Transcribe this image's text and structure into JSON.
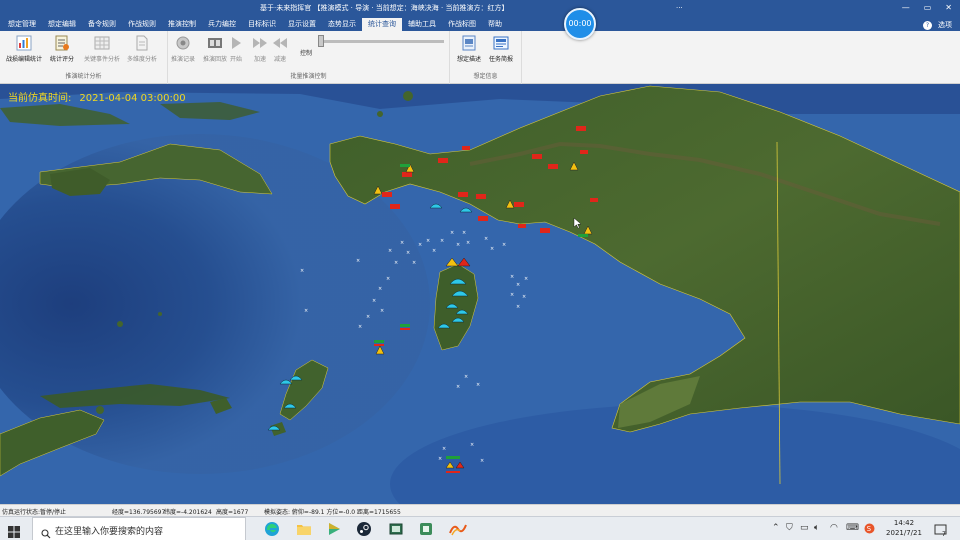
{
  "window": {
    "doc_title": "基于·未来指挥官 【推演模式 · 导演 · 当前想定：海峡决海 · 当前推演方：红方】",
    "title_dots": "...",
    "controls": [
      "—",
      "▭",
      "✕"
    ],
    "clock": "00:00",
    "options_label": "选项"
  },
  "tabs": [
    {
      "label": "想定管理",
      "active": false
    },
    {
      "label": "想定编辑",
      "active": false
    },
    {
      "label": "备令规则",
      "active": false
    },
    {
      "label": "作战规则",
      "active": false
    },
    {
      "label": "推演控制",
      "active": false
    },
    {
      "label": "兵力编控",
      "active": false
    },
    {
      "label": "目标标识",
      "active": false
    },
    {
      "label": "显示设置",
      "active": false
    },
    {
      "label": "态势显示",
      "active": false
    },
    {
      "label": "统计查询",
      "active": true
    },
    {
      "label": "辅助工具",
      "active": false
    },
    {
      "label": "作战标图",
      "active": false
    },
    {
      "label": "帮助",
      "active": false
    }
  ],
  "ribbon": {
    "groups": [
      {
        "label": "推演统计分析",
        "buttons": [
          {
            "label": "战损编辑统计",
            "icon": "bar-chart-icon",
            "enabled": true
          },
          {
            "label": "统计评分",
            "icon": "score-sheet-icon",
            "enabled": true
          },
          {
            "label": "关键事件分析",
            "icon": "event-grid-icon",
            "enabled": false
          },
          {
            "label": "多维度分析",
            "icon": "document-icon",
            "enabled": false
          }
        ]
      },
      {
        "label": "批量推演控制",
        "buttons": [
          {
            "label": "推演记录",
            "icon": "record-icon",
            "enabled": false
          },
          {
            "label": "推演回放",
            "icon": "film-icon",
            "enabled": false
          },
          {
            "label": "开始",
            "icon": "play-icon",
            "enabled": false
          },
          {
            "label": "加速",
            "icon": "fast-forward-icon",
            "enabled": false
          },
          {
            "label": "减速",
            "icon": "rewind-icon",
            "enabled": false
          }
        ],
        "slider_label": "控制"
      },
      {
        "label": "想定信息",
        "buttons": [
          {
            "label": "想定描述",
            "icon": "scenario-doc-icon",
            "enabled": true
          },
          {
            "label": "任务简报",
            "icon": "briefing-icon",
            "enabled": true
          }
        ]
      }
    ]
  },
  "map": {
    "sim_time_label": "当前仿真时间:",
    "sim_time_value": "2021-04-04 03:00:00"
  },
  "statusbar": {
    "state": "仿真运行状态:暂停/停止",
    "lon": "经度=136.795697",
    "lat": "纬度=-4.201624",
    "alt": "高度=1677",
    "info": "模拟姿态: 俯仰=-89.1  方位=-0.0  距离=1715655"
  },
  "taskbar": {
    "search_placeholder": "在这里输入你要搜索的内容",
    "time": "14:42",
    "date": "2021/7/21",
    "notifications": "7"
  },
  "colors": {
    "accent": "#2b579a",
    "sim_time": "#f2d820",
    "ocean_deep": "#1e3f7a",
    "land": "#3d5a2a",
    "red_unit": "#e0261a",
    "blue_unit": "#2ec8e8"
  }
}
